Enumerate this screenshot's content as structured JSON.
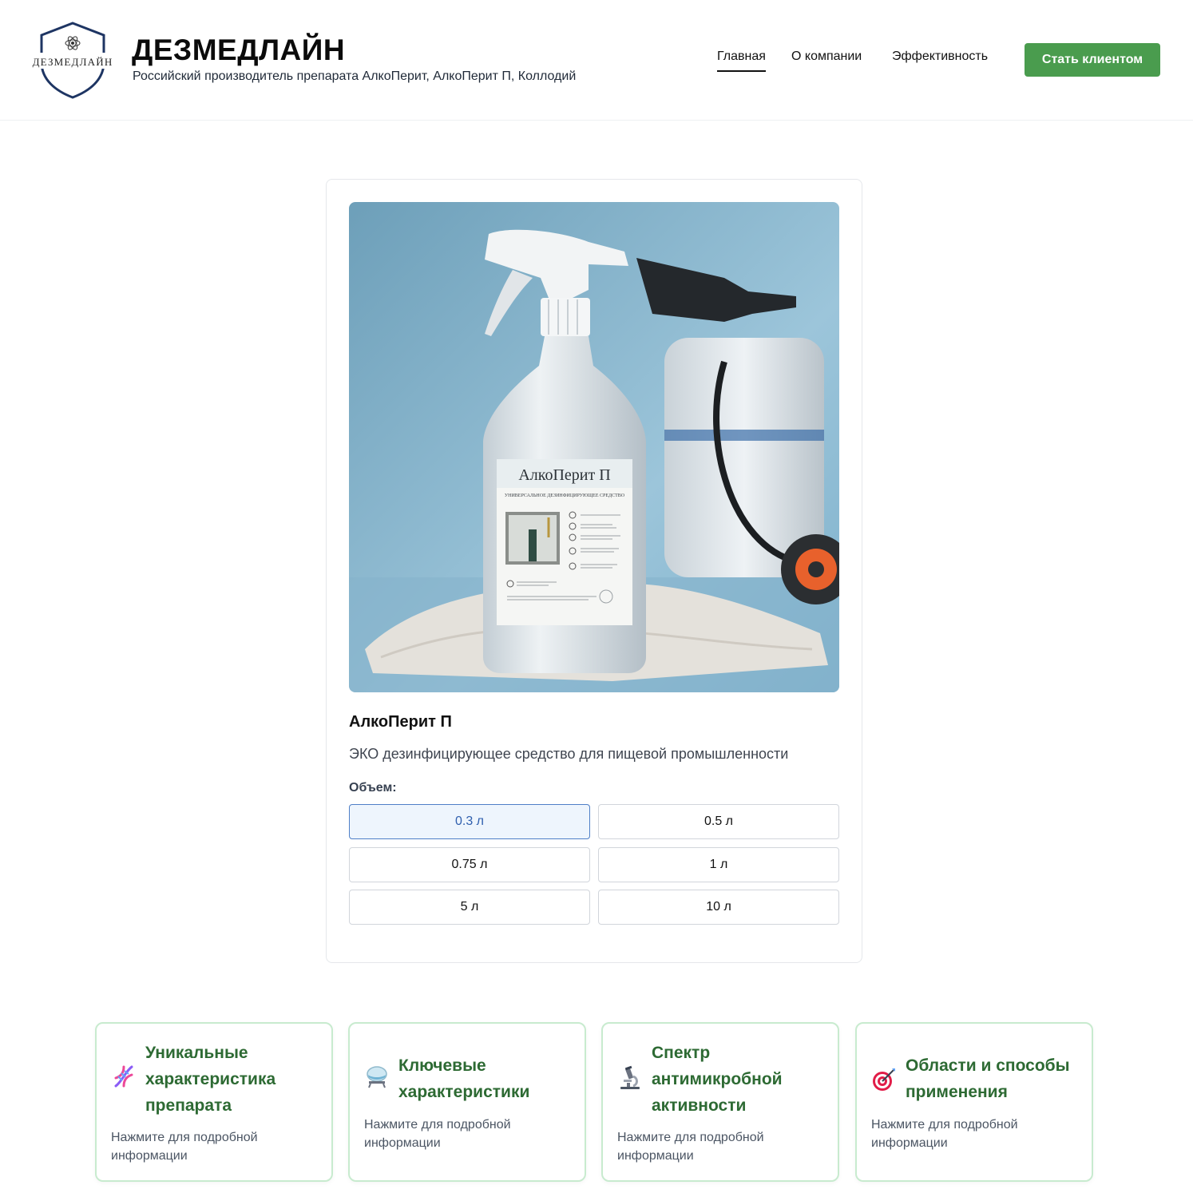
{
  "header": {
    "logo_text": "ДЕЗМЕДЛАЙН",
    "brand_title": "ДЕЗМЕДЛАЙН",
    "brand_subtitle": "Российский производитель препарата АлкоПерит, АлкоПерит П, Коллодий",
    "nav": [
      {
        "label": "Главная",
        "active": true
      },
      {
        "label": "О компании",
        "active": false
      },
      {
        "label": "Эффективность",
        "active": false
      }
    ],
    "cta_label": "Стать клиентом"
  },
  "product": {
    "image_label": "АлкоПерит П",
    "image_sublabel": "УНИВЕРСАЛЬНОЕ ДЕЗИНФИЦИРУЮЩЕЕ СРЕДСТВО",
    "name": "АлкоПерит П",
    "description": "ЭКО дезинфицирующее средство для пищевой промышленности",
    "volume_label": "Объем:",
    "volumes": [
      "0.3 л",
      "0.5 л",
      "0.75 л",
      "1 л",
      "5 л",
      "10 л"
    ],
    "selected_volume": "0.3 л"
  },
  "features": [
    {
      "icon": "dna-icon",
      "title": "Уникальные характеристика препарата",
      "hint": "Нажмите для подробной информации"
    },
    {
      "icon": "flask-icon",
      "title": "Ключевые характеристики",
      "hint": "Нажмите для подробной информации"
    },
    {
      "icon": "microscope-icon",
      "title": "Спектр антимикробной активности",
      "hint": "Нажмите для подробной информации"
    },
    {
      "icon": "target-icon",
      "title": "Области и способы применения",
      "hint": "Нажмите для подробной информации"
    }
  ],
  "colors": {
    "accent_green": "#4a9c4e",
    "feature_title": "#2d6a33",
    "feature_border": "#c8ebcf",
    "selected_border": "#4f7fc7",
    "logo_navy": "#1e3563"
  }
}
